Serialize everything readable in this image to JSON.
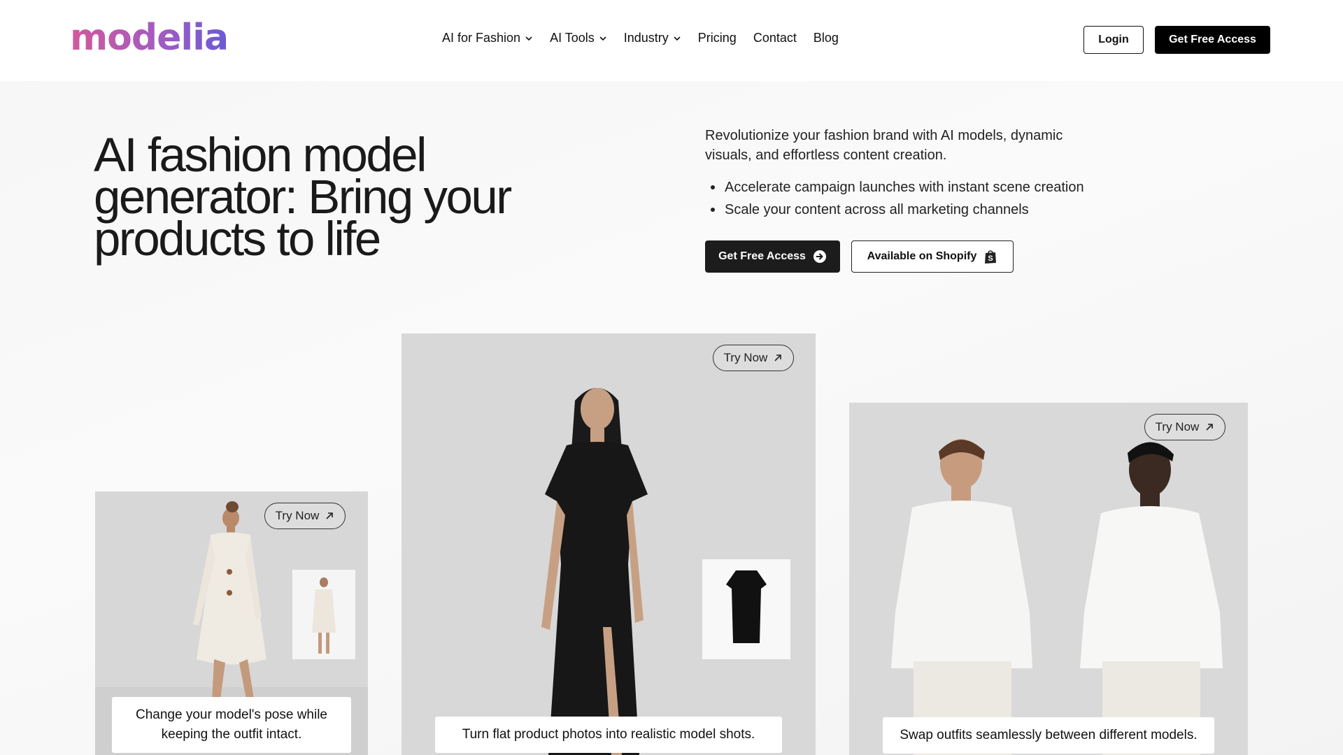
{
  "header": {
    "logo": "modelia",
    "nav": [
      {
        "label": "AI for Fashion",
        "dropdown": true
      },
      {
        "label": "AI Tools",
        "dropdown": true
      },
      {
        "label": "Industry",
        "dropdown": true
      },
      {
        "label": "Pricing",
        "dropdown": false
      },
      {
        "label": "Contact",
        "dropdown": false
      },
      {
        "label": "Blog",
        "dropdown": false
      }
    ],
    "login_label": "Login",
    "cta_label": "Get Free Access"
  },
  "hero": {
    "title_lines": [
      "AI fashion model",
      "generator: Bring your",
      "products to life"
    ],
    "lead": "Revolutionize your fashion brand with AI models, dynamic visuals, and effortless content creation.",
    "bullets": [
      "Accelerate campaign launches with instant scene creation",
      "Scale your content across all marketing channels"
    ],
    "cta_label": "Get Free Access",
    "shopify_label": "Available on Shopify"
  },
  "cards": [
    {
      "try_label": "Try Now",
      "caption": "Change your model's pose while keeping the outfit intact."
    },
    {
      "try_label": "Try Now",
      "caption": "Turn flat product photos into realistic model shots."
    },
    {
      "try_label": "Try Now",
      "caption": "Swap outfits seamlessly between different models."
    }
  ],
  "colors": {
    "logo_gradient": [
      "#d25a9b",
      "#a45bc0",
      "#6a5bd6"
    ],
    "primary_button": "#000000",
    "card_background": "#d9d9d9"
  },
  "icons": {
    "nav_dropdown": "chevron-down-icon",
    "hero_cta": "arrow-right-circle-icon",
    "shopify": "shopify-bag-icon",
    "try_now": "arrow-up-right-icon"
  }
}
